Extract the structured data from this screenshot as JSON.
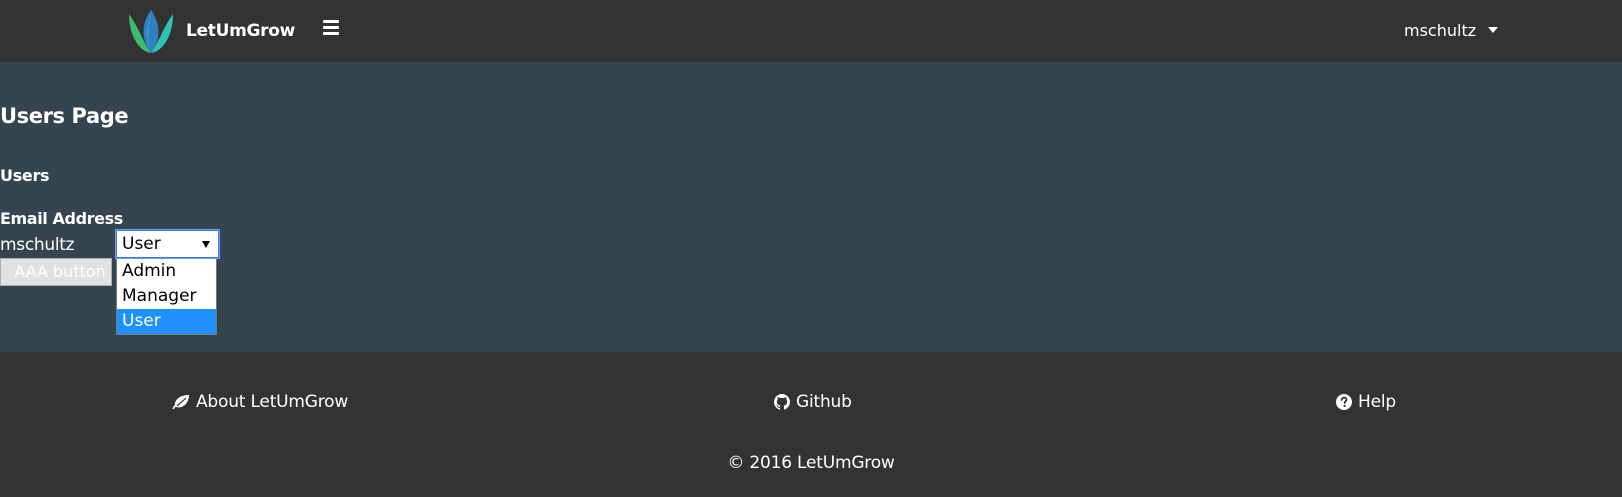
{
  "navbar": {
    "brand_name": "LetUmGrow",
    "brand_icon": "lotus-leaf-logo",
    "menu_icon": "hamburger-icon",
    "user_name": "mschultz",
    "user_caret_icon": "caret-down-icon"
  },
  "content": {
    "page_title": "Users Page",
    "section_title": "Users",
    "column_header": "Email Address",
    "users": [
      {
        "name": "mschultz",
        "role": "User"
      }
    ],
    "role_select": {
      "value": "User",
      "options": [
        "Admin",
        "Manager",
        "User"
      ],
      "highlighted": "User"
    },
    "button_label": "AAA button"
  },
  "footer": {
    "links": [
      {
        "label": "About LetUmGrow",
        "icon": "leaf-icon"
      },
      {
        "label": "Github",
        "icon": "github-icon"
      },
      {
        "label": "Help",
        "icon": "question-circle-icon"
      }
    ],
    "copyright": "© 2016 LetUmGrow"
  },
  "colors": {
    "navbar_bg": "#333333",
    "content_bg": "#34454f",
    "footer_bg": "#333333",
    "option_highlight": "#1e90ff",
    "logo_green": "#3dbb6e",
    "logo_teal": "#2fc4b2",
    "logo_blue": "#2f7fc1"
  }
}
